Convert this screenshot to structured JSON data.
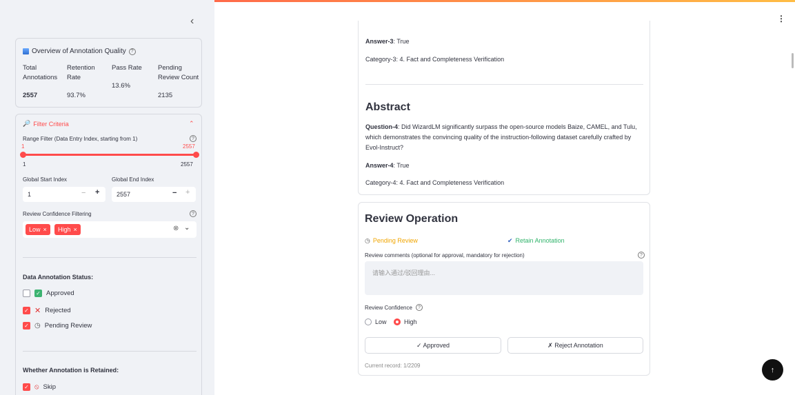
{
  "sidebar": {
    "collapse_icon": "chevron-left-icon",
    "overview": {
      "title": "Overview of Annotation Quality",
      "metrics": [
        {
          "label": "Total Annotations",
          "value": "2557"
        },
        {
          "label": "Retention Rate",
          "value": "93.7%"
        },
        {
          "label": "Pass Rate",
          "value": "13.6%"
        },
        {
          "label": "Pending Review Count",
          "value": "2135"
        }
      ]
    },
    "filter": {
      "title": "Filter Criteria",
      "range_label": "Range Filter (Data Entry Index, starting from 1)",
      "range_low": "1",
      "range_high": "2557",
      "range_min": "1",
      "range_max": "2557",
      "start_label": "Global Start Index",
      "start_value": "1",
      "end_label": "Global End Index",
      "end_value": "2557",
      "confidence_label": "Review Confidence Filtering",
      "confidence_chips": [
        "Low",
        "High"
      ],
      "status_title": "Data Annotation Status:",
      "status_items": [
        {
          "label": "Approved",
          "checked": false,
          "emoji": "✅"
        },
        {
          "label": "Rejected",
          "checked": true,
          "emoji": "❌"
        },
        {
          "label": "Pending Review",
          "checked": true,
          "emoji": "🕒"
        }
      ],
      "retained_title": "Whether Annotation is Retained:",
      "retained_items": [
        {
          "label": "Skip",
          "checked": true,
          "emoji": "🚫"
        }
      ]
    }
  },
  "content": {
    "answer3": {
      "key": "Answer-3",
      "value": ": True"
    },
    "category3": "Category-3: 4. Fact and Completeness Verification",
    "abstract_title": "Abstract",
    "question4_key": "Question-4",
    "question4_text": ": Did WizardLM significantly surpass the open-source models Baize, CAMEL, and Tulu, which demonstrates the convincing quality of the instruction-following dataset carefully crafted by Evol-Instruct?",
    "answer4": {
      "key": "Answer-4",
      "value": ": True"
    },
    "category4": "Category-4: 4. Fact and Completeness Verification"
  },
  "review": {
    "title": "Review Operation",
    "pending": "Pending Review",
    "retain": "Retain Annotation",
    "comments_label": "Review comments (optional for approval, mandatory for rejection)",
    "comments_placeholder": "请输入通过/驳回理由...",
    "confidence_label": "Review Confidence",
    "options": [
      {
        "label": "Low",
        "selected": false
      },
      {
        "label": "High",
        "selected": true
      }
    ],
    "approve_label": "✓ Approved",
    "reject_label": "✗ Reject Annotation",
    "current_record": "Current record: 1/2209"
  },
  "colors": {
    "accent": "#ff4b4b",
    "pending": "#f0a500",
    "retain": "#2fb36a"
  }
}
